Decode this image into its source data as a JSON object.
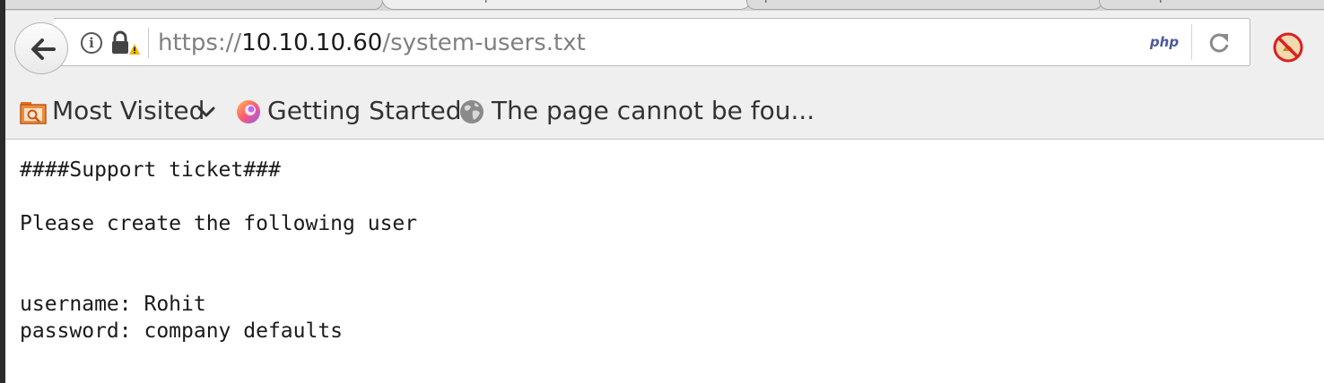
{
  "browser": {
    "tabs": [
      {
        "label": "p",
        "state": "active"
      },
      {
        "label": "p",
        "state": "inactive"
      },
      {
        "label": "p",
        "state": "inactive"
      }
    ],
    "url": {
      "scheme": "https://",
      "host": "10.10.10.60",
      "path": "/system-users.txt"
    },
    "php_badge": "php",
    "icons": {
      "back": "back-arrow-icon",
      "info": "info-icon",
      "lock": "lock-warning-icon",
      "php": "php-icon",
      "reload": "reload-icon",
      "noscript": "noscript-icon"
    }
  },
  "bookmarks": {
    "items": [
      {
        "label": "Most Visited",
        "icon": "folder-icon",
        "has_dropdown": true
      },
      {
        "label": "Getting Started",
        "icon": "firefox-icon"
      },
      {
        "label": "The page cannot be fou...",
        "icon": "globe-icon"
      }
    ]
  },
  "content": {
    "lines": [
      "####Support ticket###",
      "Please create the following user",
      "username: Rohit",
      "password: company defaults"
    ]
  },
  "colors": {
    "chrome_bg": "#efefef",
    "url_host": "#1a1a1a",
    "url_dim": "#808080",
    "warning": "#f5b400"
  }
}
